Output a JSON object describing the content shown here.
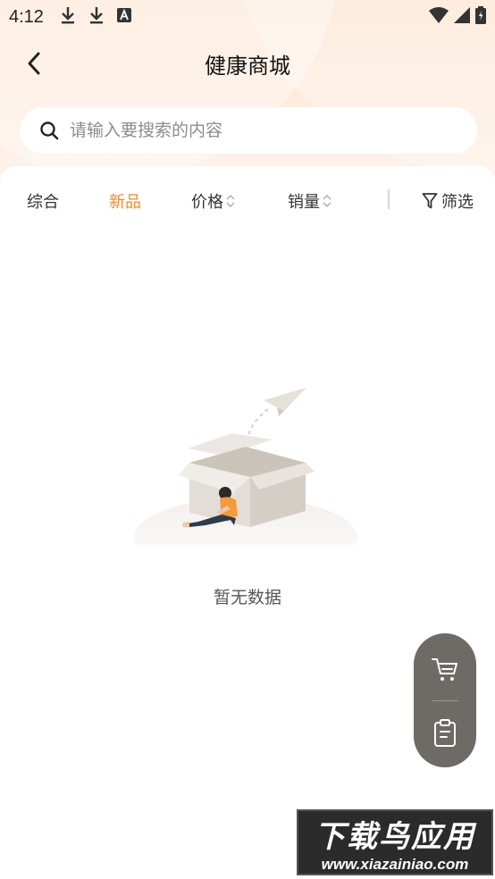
{
  "status_bar": {
    "time": "4:12",
    "icons_left": [
      "download-icon",
      "download-icon",
      "text-icon"
    ],
    "icons_right": [
      "wifi-icon",
      "signal-icon",
      "battery-icon"
    ]
  },
  "header": {
    "title": "健康商城",
    "back_icon": "chevron-left-icon"
  },
  "search": {
    "placeholder": "请输入要搜索的内容",
    "value": ""
  },
  "sort_tabs": {
    "items": [
      {
        "label": "综合",
        "active": false,
        "sortable": false
      },
      {
        "label": "新品",
        "active": true,
        "sortable": false
      },
      {
        "label": "价格",
        "active": false,
        "sortable": true
      },
      {
        "label": "销量",
        "active": false,
        "sortable": true
      }
    ],
    "filter_label": "筛选"
  },
  "empty_state": {
    "message": "暂无数据"
  },
  "float_actions": {
    "items": [
      {
        "icon": "cart-icon"
      },
      {
        "icon": "clipboard-icon"
      }
    ]
  },
  "watermark": {
    "title": "下载鸟应用",
    "url": "www.xiazainiao.com"
  },
  "colors": {
    "accent": "#ee8a32",
    "float_panel": "#6e6a66",
    "header_bg": "#fce6d4"
  }
}
